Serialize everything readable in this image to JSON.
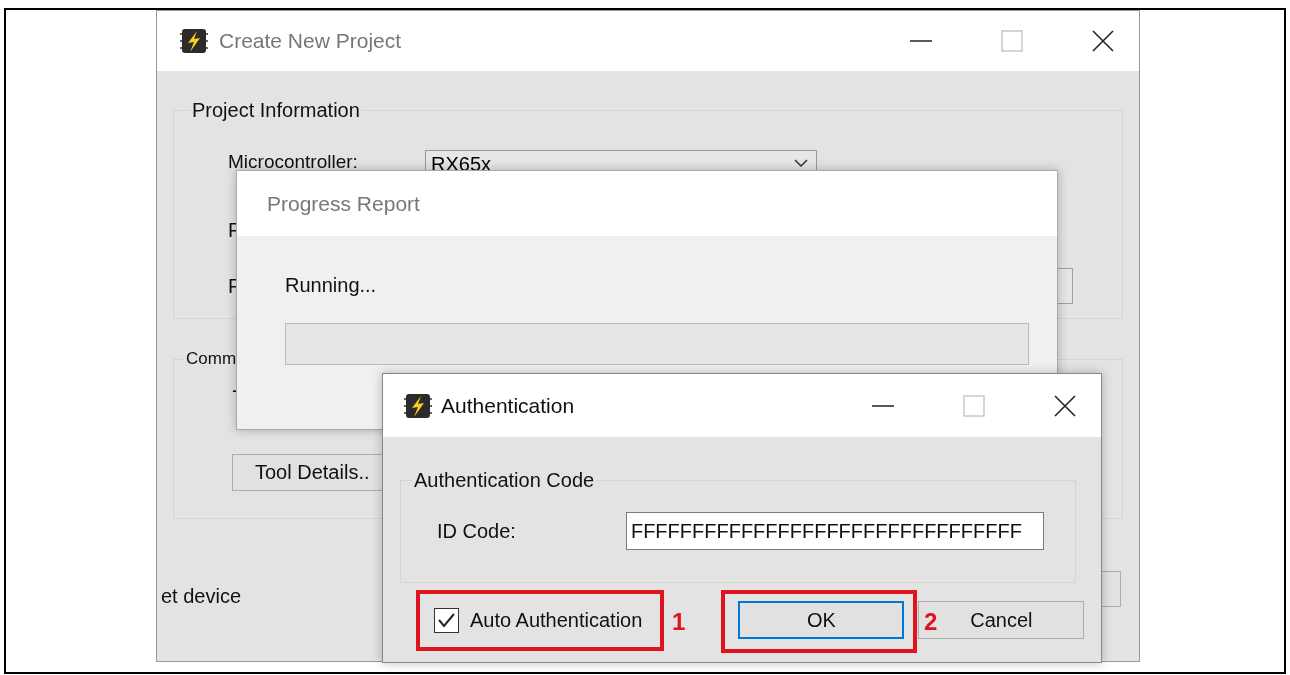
{
  "main_window": {
    "title": "Create New Project",
    "active": false,
    "project_information": {
      "title": "Project Information",
      "microcontroller_label": "Microcontroller:",
      "microcontroller_value": "RX65x",
      "row_2_label": "F",
      "row_3_label": "F"
    },
    "communication": {
      "title": "Comm",
      "row_1_label": "-",
      "tool_details_button": "Tool Details.."
    },
    "status_text": "et device"
  },
  "progress_window": {
    "title": "Progress Report",
    "active": false,
    "message": "Running...",
    "progress": {
      "level": 0
    }
  },
  "auth_window": {
    "title": "Authentication",
    "active": true,
    "group_title": "Authentication Code",
    "id_code_label": "ID Code:",
    "id_code_value": "FFFFFFFFFFFFFFFFFFFFFFFFFFFFFFFF",
    "auto_authentication": {
      "label": "Auto Authentication",
      "checked": true
    },
    "buttons": [
      {
        "label": "OK",
        "default": true
      },
      {
        "label": "Cancel",
        "default": false
      }
    ]
  },
  "annotations": [
    {
      "label": "1"
    },
    {
      "label": "2"
    }
  ]
}
